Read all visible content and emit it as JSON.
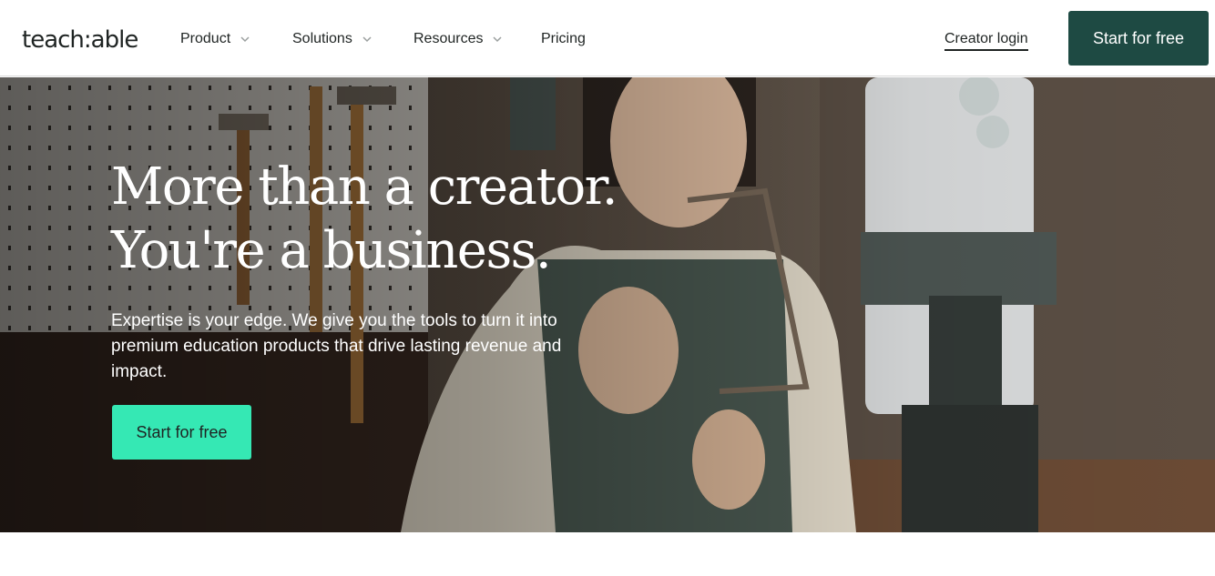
{
  "header": {
    "logo": "teach:able",
    "nav": [
      {
        "label": "Product",
        "has_dropdown": true
      },
      {
        "label": "Solutions",
        "has_dropdown": true
      },
      {
        "label": "Resources",
        "has_dropdown": true
      },
      {
        "label": "Pricing",
        "has_dropdown": false
      }
    ],
    "login_label": "Creator login",
    "cta_label": "Start for free"
  },
  "hero": {
    "headline_line1": "More than a creator.",
    "headline_line2": "You're a business.",
    "subtext": "Expertise is your edge. We give you the tools to turn it into premium education products that drive lasting revenue and impact.",
    "cta_label": "Start for free"
  },
  "colors": {
    "brand_dark": "#1e4a43",
    "accent_mint": "#35e8b4",
    "text_dark": "#1f2423"
  }
}
